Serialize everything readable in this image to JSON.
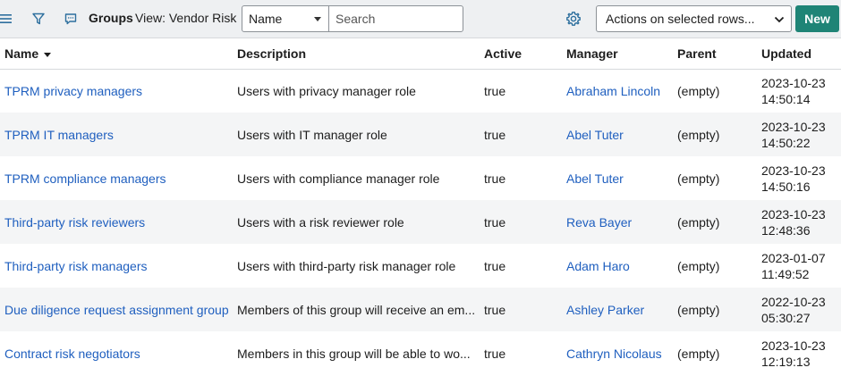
{
  "toolbar": {
    "title": "Groups",
    "view_label": "View: Vendor Risk",
    "filter_field": "Name",
    "search_placeholder": "Search",
    "actions_label": "Actions on selected rows...",
    "new_label": "New"
  },
  "colors": {
    "accent": "#1f8476",
    "link": "#1f5fbf",
    "toolbar_bg": "#eef0f2",
    "row_alt": "#f4f5f6"
  },
  "icons": [
    "menu-icon",
    "filter-icon",
    "chat-icon",
    "gear-icon",
    "chevron-down-icon",
    "sort-down-icon"
  ],
  "table": {
    "columns": [
      "Name",
      "Description",
      "Active",
      "Manager",
      "Parent",
      "Updated"
    ],
    "sorted_by": "Name",
    "rows": [
      {
        "name": "TPRM privacy managers",
        "description": "Users with privacy manager role",
        "active": "true",
        "manager": "Abraham Lincoln",
        "parent": "(empty)",
        "updated_date": "2023-10-23",
        "updated_time": "14:50:14"
      },
      {
        "name": "TPRM IT managers",
        "description": "Users with IT manager role",
        "active": "true",
        "manager": "Abel Tuter",
        "parent": "(empty)",
        "updated_date": "2023-10-23",
        "updated_time": "14:50:22"
      },
      {
        "name": "TPRM compliance managers",
        "description": "Users with compliance manager role",
        "active": "true",
        "manager": "Abel Tuter",
        "parent": "(empty)",
        "updated_date": "2023-10-23",
        "updated_time": "14:50:16"
      },
      {
        "name": "Third-party risk reviewers",
        "description": "Users with a risk reviewer role",
        "active": "true",
        "manager": "Reva Bayer",
        "parent": "(empty)",
        "updated_date": "2023-10-23",
        "updated_time": "12:48:36"
      },
      {
        "name": "Third-party risk managers",
        "description": "Users with third-party risk manager role",
        "active": "true",
        "manager": "Adam Haro",
        "parent": "(empty)",
        "updated_date": "2023-01-07",
        "updated_time": "11:49:52"
      },
      {
        "name": "Due diligence request assignment group",
        "description": "Members of this group will receive an em...",
        "active": "true",
        "manager": "Ashley Parker",
        "parent": "(empty)",
        "updated_date": "2022-10-23",
        "updated_time": "05:30:27"
      },
      {
        "name": "Contract risk negotiators",
        "description": "Members in this group will be able to wo...",
        "active": "true",
        "manager": "Cathryn Nicolaus",
        "parent": "(empty)",
        "updated_date": "2023-10-23",
        "updated_time": "12:19:13"
      }
    ]
  }
}
